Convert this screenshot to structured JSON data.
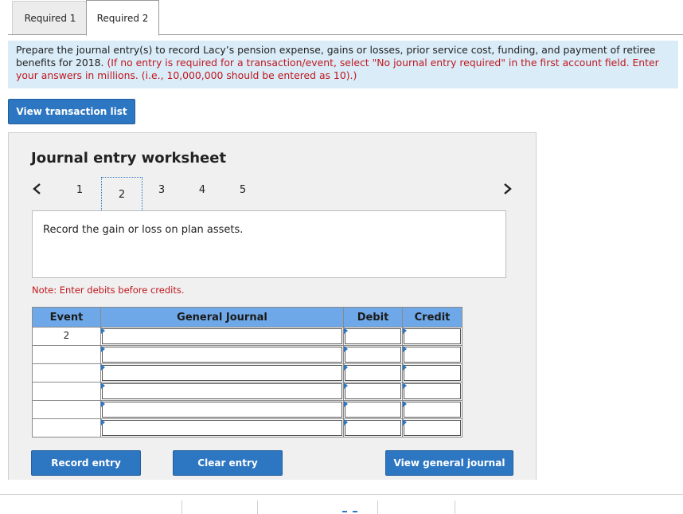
{
  "tabs": [
    {
      "label": "Required 1"
    },
    {
      "label": "Required 2"
    }
  ],
  "instructions": {
    "main": "Prepare the journal entry(s) to record Lacy’s pension expense, gains or losses, prior service cost, funding, and payment of retiree benefits for 2018.",
    "note": "(If no entry is required for a transaction/event, select \"No journal entry required\" in the first account field. Enter your answers in millions. (i.e., 10,000,000 should be entered as 10).)"
  },
  "buttons": {
    "view_transaction_list": "View transaction list",
    "record_entry": "Record entry",
    "clear_entry": "Clear entry",
    "view_general_journal": "View general journal"
  },
  "worksheet": {
    "title": "Journal entry worksheet",
    "steps": [
      "1",
      "2",
      "3",
      "4",
      "5"
    ],
    "active_step": "2",
    "description": "Record the gain or loss on plan assets.",
    "note": "Note: Enter debits before credits."
  },
  "table": {
    "headers": {
      "event": "Event",
      "general_journal": "General Journal",
      "debit": "Debit",
      "credit": "Credit"
    },
    "rows": [
      {
        "event": "2",
        "account": "",
        "debit": "",
        "credit": ""
      },
      {
        "event": "",
        "account": "",
        "debit": "",
        "credit": ""
      },
      {
        "event": "",
        "account": "",
        "debit": "",
        "credit": ""
      },
      {
        "event": "",
        "account": "",
        "debit": "",
        "credit": ""
      },
      {
        "event": "",
        "account": "",
        "debit": "",
        "credit": ""
      },
      {
        "event": "",
        "account": "",
        "debit": "",
        "credit": ""
      }
    ]
  },
  "colors": {
    "button_blue": "#2c76c2",
    "header_blue": "#6fa8e8",
    "instruction_bg": "#d9ecf8",
    "note_red": "#c0171d"
  }
}
